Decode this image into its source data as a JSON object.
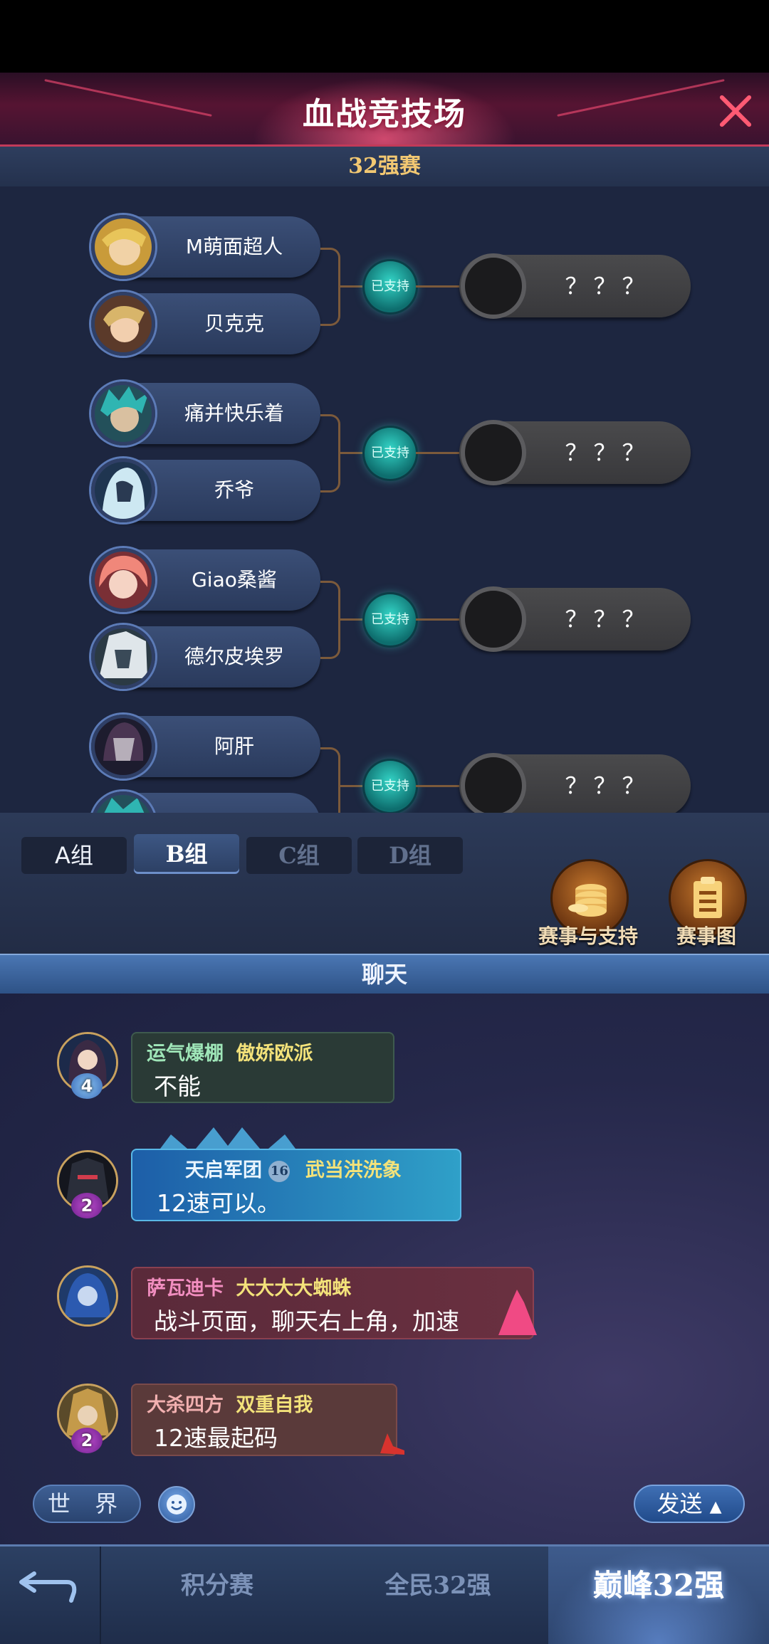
{
  "header": {
    "title": "血战竞技场"
  },
  "round": {
    "title": "32强赛"
  },
  "bracket": {
    "matches": [
      {
        "players": [
          {
            "name": "M萌面超人"
          },
          {
            "name": "贝克克"
          }
        ],
        "support_label": "已支持",
        "winner_name": "？？？"
      },
      {
        "players": [
          {
            "name": "痛并快乐着"
          },
          {
            "name": "乔爷"
          }
        ],
        "support_label": "已支持",
        "winner_name": "？？？"
      },
      {
        "players": [
          {
            "name": "Giao桑酱"
          },
          {
            "name": "德尔皮埃罗"
          }
        ],
        "support_label": "已支持",
        "winner_name": "？？？"
      },
      {
        "players": [
          {
            "name": "阿肝"
          },
          {
            "name": ""
          }
        ],
        "support_label": "已支持",
        "winner_name": "？？？"
      }
    ]
  },
  "groups": {
    "tabs": [
      {
        "label": "A组"
      },
      {
        "label": "B组"
      },
      {
        "label": "C组"
      },
      {
        "label": "D组"
      }
    ],
    "active": "B组"
  },
  "actions": {
    "events_support": {
      "label": "赛事与支持",
      "icon": "coins-icon"
    },
    "bracket_chart": {
      "label": "赛事图",
      "icon": "clipboard-icon"
    }
  },
  "chat": {
    "title": "聊天",
    "messages": [
      {
        "guild": "运气爆棚",
        "name": "傲娇欧派",
        "text": "不能",
        "vip": "4"
      },
      {
        "guild": "天启军团",
        "guild_level": "16",
        "name": "武当洪洗象",
        "text": "12速可以。",
        "vip": "2"
      },
      {
        "guild": "萨瓦迪卡",
        "name": "大大大大蜘蛛",
        "text": "战斗页面，聊天右上角，加速",
        "vip": ""
      },
      {
        "guild": "大杀四方",
        "name": "双重自我",
        "text": "12速最起码",
        "vip": "2"
      }
    ],
    "channel_label": "世 界",
    "send_label": "发送"
  },
  "bottom_nav": {
    "tabs": [
      {
        "label": "积分赛"
      },
      {
        "label": "全民32强"
      },
      {
        "label": "巅峰32强"
      }
    ],
    "active": "巅峰32强"
  },
  "colors": {
    "accent_gold": "#f2c872",
    "support_teal": "#33d4c6",
    "title_red": "#c23a59"
  }
}
